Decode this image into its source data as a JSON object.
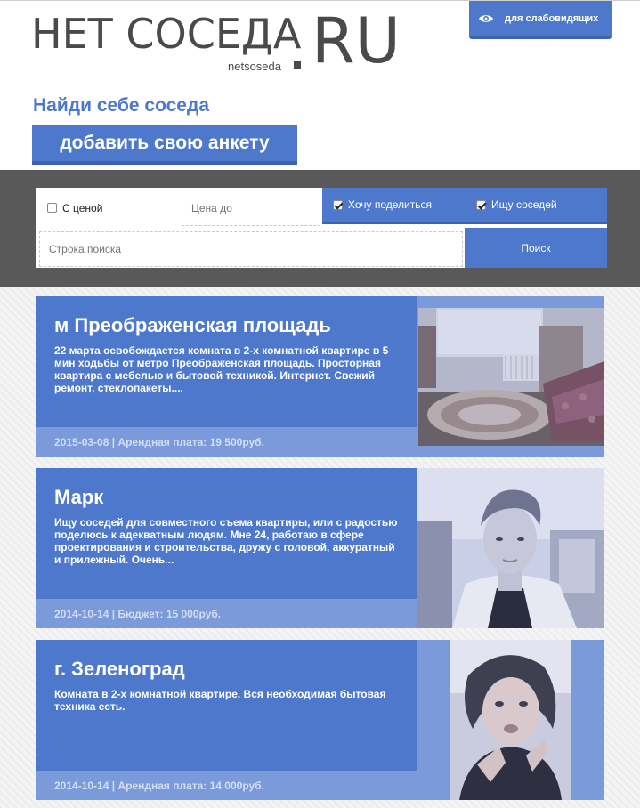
{
  "header": {
    "logo_main": "НЕТ СОСЕДА",
    "logo_ru": "RU",
    "logo_sub": "netsoseda",
    "vision_button": "для слабовидящих",
    "tagline": "Найди себе соседа",
    "add_button": "добавить свою анкету"
  },
  "filters": {
    "price_checkbox_label": "С ценой",
    "price_checkbox_checked": false,
    "price_placeholder": "Цена до",
    "share_label": "Хочу поделиться",
    "share_checked": true,
    "seek_label": "Ищу соседей",
    "seek_checked": true,
    "search_placeholder": "Строка поиска",
    "search_button": "Поиск"
  },
  "listings": [
    {
      "title": "м Преображенская площадь",
      "description": "22 марта освобождается комната в 2-х комнатной квартире в 5 мин ходьбы от метро Преображенская площадь. Просторная квартира с мебелью и бытовой техникой. Интернет. Свежий ремонт, стеклопакеты....",
      "footer": "2015-03-08 | Арендная плата: 19 500руб.",
      "photo": "room-photo"
    },
    {
      "title": "Марк",
      "description": "Ищу соседей для совместного съема квартиры, или с радостью поделюсь к адекватным людям. Мне 24, работаю в сфере проектирования и строительства, дружу с головой, аккуратный и прилежный. Очень...",
      "footer": "2014-10-14 | Бюджет: 15 000руб.",
      "photo": "portrait-photo"
    },
    {
      "title": "г. Зеленоград",
      "description": "Комната в 2-х комнатной квартире. Вся необходимая бытовая техника есть.",
      "footer": "2014-10-14 | Арендная плата: 14 000руб.",
      "photo": "selfie-photo"
    }
  ],
  "colors": {
    "brand_blue": "#4d78cc",
    "footer_blue": "#7b9ada",
    "dark_bar": "#595959"
  }
}
